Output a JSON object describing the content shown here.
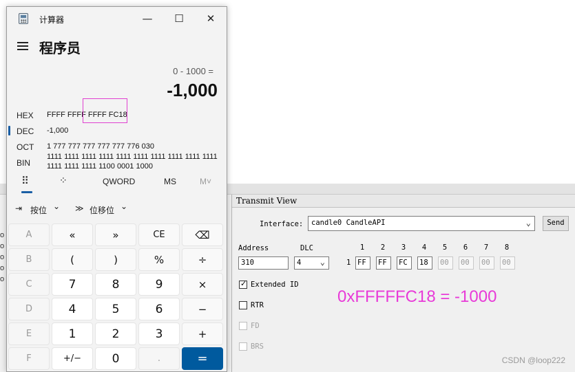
{
  "calculator": {
    "window_title": "计算器",
    "window_buttons": {
      "minimize": "—",
      "maximize": "☐",
      "close": "✕"
    },
    "mode_title": "程序员",
    "expression": "0 - 1000 =",
    "result": "-1,000",
    "radix": [
      {
        "label": "HEX",
        "value": "FFFF FFFF FFFF FC18",
        "selected": false
      },
      {
        "label": "DEC",
        "value": "-1,000",
        "selected": true
      },
      {
        "label": "OCT",
        "value": "1 777 777 777 777 777 776 030",
        "selected": false
      },
      {
        "label": "BIN",
        "value": "1111 1111 1111 1111 1111 1111 1111 1111 1111 1111 1111 1111 1111 1100 0001 1000",
        "selected": false
      }
    ],
    "tabs": {
      "keypad_icon": "⠿",
      "bit_icon": "⁘",
      "word_size": "QWORD",
      "memory_store": "MS",
      "memory_recall": "M˅"
    },
    "toolbar": {
      "bitwise_icon": "⇥",
      "bitwise_label": "按位",
      "bitwise_chevron": "⌄",
      "shift_icon": "≫",
      "shift_label": "位移位",
      "shift_chevron": "⌄"
    },
    "keys": [
      [
        "A",
        "«",
        "»",
        "CE",
        "⌫"
      ],
      [
        "B",
        "(",
        ")",
        "%",
        "÷"
      ],
      [
        "C",
        "7",
        "8",
        "9",
        "×"
      ],
      [
        "D",
        "4",
        "5",
        "6",
        "−"
      ],
      [
        "E",
        "1",
        "2",
        "3",
        "+"
      ],
      [
        "F",
        "+/−",
        "0",
        ".",
        "="
      ]
    ]
  },
  "transmit_view": {
    "title": "Transmit View",
    "interface_label": "Interface:",
    "interface_value": "candle0 CandleAPI",
    "send_label": "Send",
    "address_label": "Address",
    "address_value": "310",
    "dlc_label": "DLC",
    "dlc_value": "4",
    "row_index": "1",
    "byte_numbers": [
      "1",
      "2",
      "3",
      "4",
      "5",
      "6",
      "7",
      "8"
    ],
    "bytes": [
      "FF",
      "FF",
      "FC",
      "18",
      "00",
      "00",
      "00",
      "00"
    ],
    "extended_id_label": "Extended ID",
    "extended_id_checked": true,
    "rtr_label": "RTR",
    "fd_label": "FD",
    "brs_label": "BRS"
  },
  "left_strip_text": [
    "o",
    "o",
    "o",
    "o",
    "o",
    "o"
  ],
  "annotation": "0xFFFFFC18 = -1000",
  "watermark": "CSDN @loop222"
}
